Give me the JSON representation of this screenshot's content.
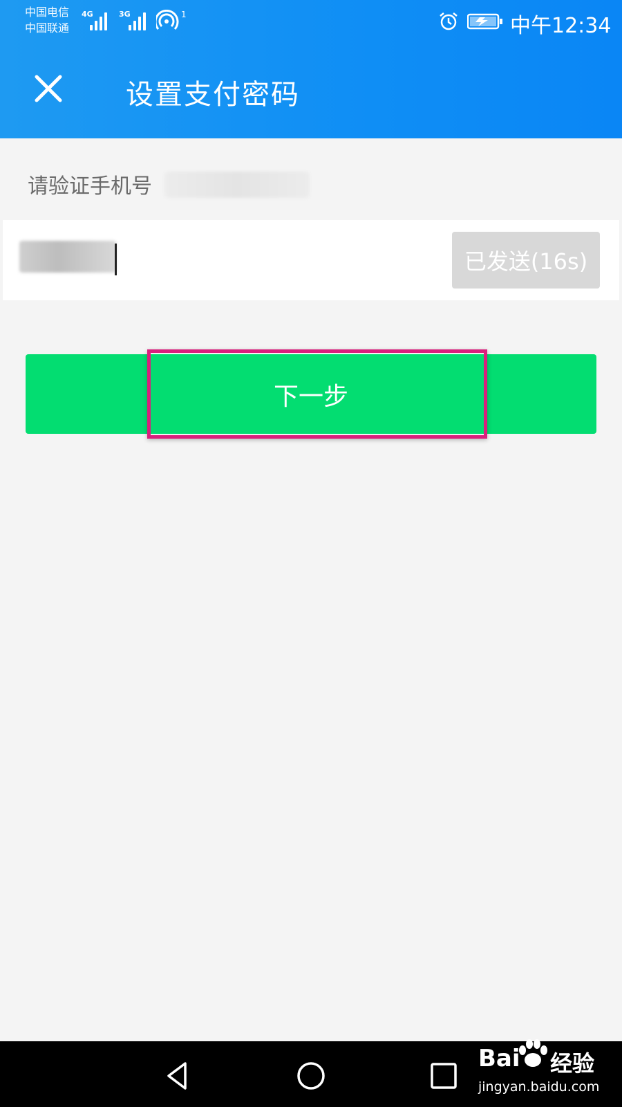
{
  "status_bar": {
    "carrier_1": "中国电信",
    "carrier_2": "中国联通",
    "network_1": "4G",
    "network_2": "3G",
    "hotspot_count": "1",
    "time": "中午12:34",
    "icons": [
      "signal-icon",
      "hotspot-icon",
      "alarm-icon",
      "battery-charging-icon"
    ]
  },
  "header": {
    "title": "设置支付密码",
    "close_icon": "close-icon",
    "background_color": "#1a96f3"
  },
  "verify": {
    "label": "请验证手机号",
    "code_field_value": "",
    "resend_label": "已发送(16s)"
  },
  "actions": {
    "next_label": "下一步",
    "next_color": "#03dd71",
    "highlight_color": "#d9207d"
  },
  "nav_bar": {
    "icons": [
      "back-icon",
      "home-icon",
      "recent-apps-icon"
    ]
  },
  "watermark": {
    "brand": "Bai",
    "brand_suffix": "经验",
    "url": "jingyan.baidu.com"
  }
}
